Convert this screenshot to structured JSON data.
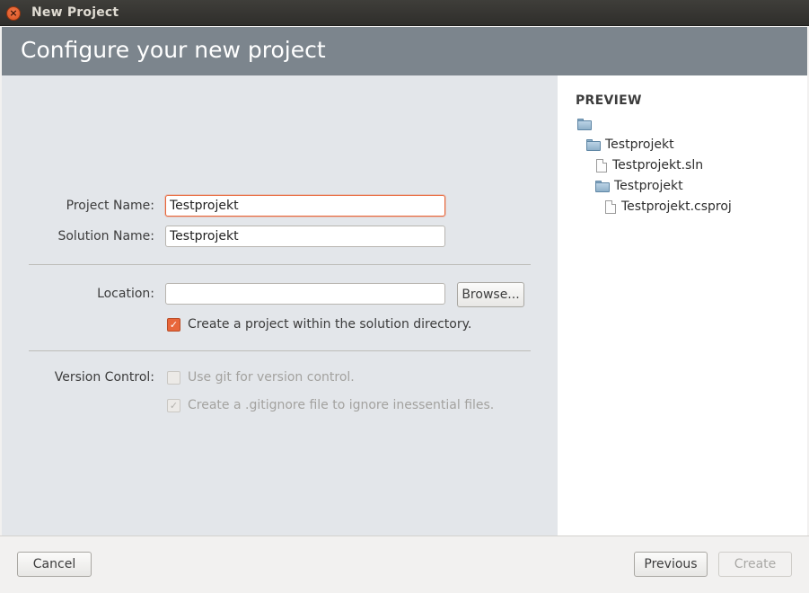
{
  "window": {
    "title": "New Project"
  },
  "header": {
    "title": "Configure your new project"
  },
  "form": {
    "project_name_label": "Project Name:",
    "project_name_value": "Testprojekt",
    "solution_name_label": "Solution Name:",
    "solution_name_value": "Testprojekt",
    "location_label": "Location:",
    "location_value": "",
    "browse_label": "Browse...",
    "create_within_solution_label": "Create a project within the solution directory.",
    "create_within_solution_checked": true,
    "version_control_label": "Version Control:",
    "use_git_label": "Use git for version control.",
    "use_git_checked": false,
    "gitignore_label": "Create a .gitignore file to ignore inessential files.",
    "gitignore_checked": true
  },
  "preview": {
    "title": "PREVIEW",
    "tree": [
      {
        "type": "folder",
        "label": ""
      },
      {
        "type": "folder",
        "label": "Testprojekt"
      },
      {
        "type": "file",
        "label": "Testprojekt.sln"
      },
      {
        "type": "folder",
        "label": "Testprojekt"
      },
      {
        "type": "file",
        "label": "Testprojekt.csproj"
      }
    ]
  },
  "footer": {
    "cancel_label": "Cancel",
    "previous_label": "Previous",
    "create_label": "Create"
  },
  "colors": {
    "accent": "#e8663a",
    "header_bg": "#7c858d",
    "form_bg": "#e3e6ea"
  }
}
